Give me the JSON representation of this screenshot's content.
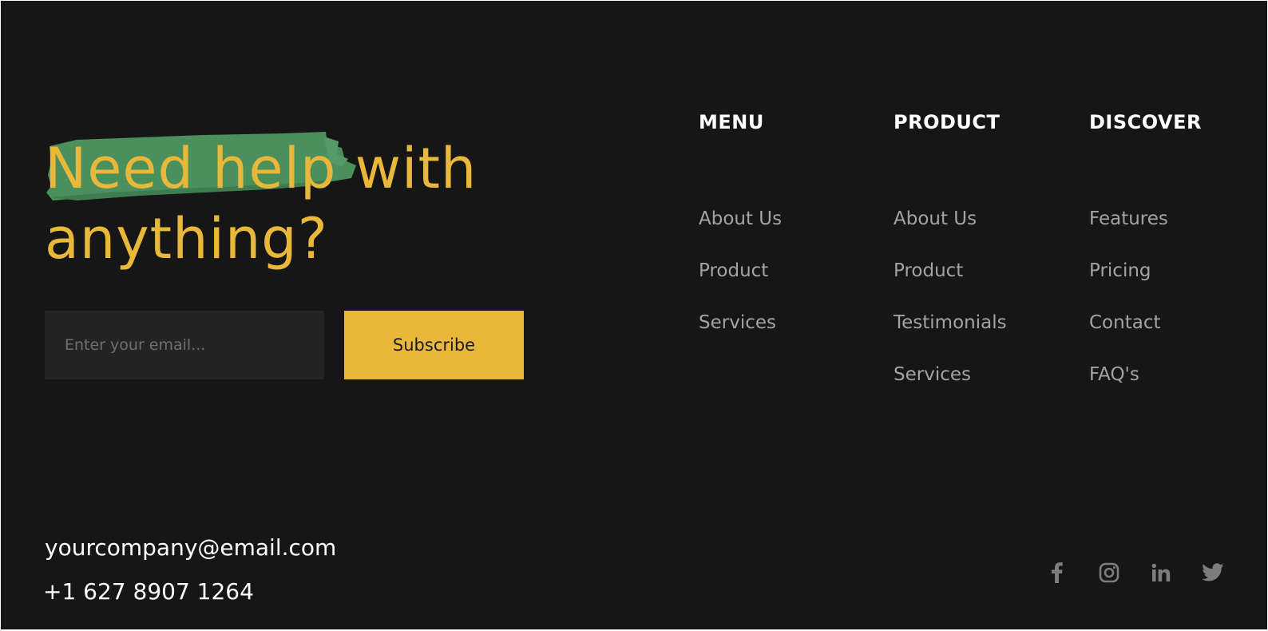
{
  "headline": {
    "line1_highlight": "Need help",
    "line1_rest": " with",
    "line2": "anything?"
  },
  "subscribe": {
    "placeholder": "Enter your email...",
    "button_label": "Subscribe"
  },
  "columns": [
    {
      "title": "MENU",
      "links": [
        "About Us",
        "Product",
        "Services"
      ]
    },
    {
      "title": "PRODUCT",
      "links": [
        "About Us",
        "Product",
        "Testimonials",
        "Services"
      ]
    },
    {
      "title": "DISCOVER",
      "links": [
        "Features",
        "Pricing",
        "Contact",
        "FAQ's"
      ]
    }
  ],
  "contact": {
    "email": "yourcompany@email.com",
    "phone": "+1 627 8907 1264"
  },
  "social": [
    "facebook-icon",
    "instagram-icon",
    "linkedin-icon",
    "twitter-icon"
  ],
  "colors": {
    "background": "#161616",
    "accent": "#e9b83b",
    "brush": "#4a8f5c",
    "link": "#a3a3a3",
    "heading": "#ffffff",
    "input_bg": "#242424"
  }
}
